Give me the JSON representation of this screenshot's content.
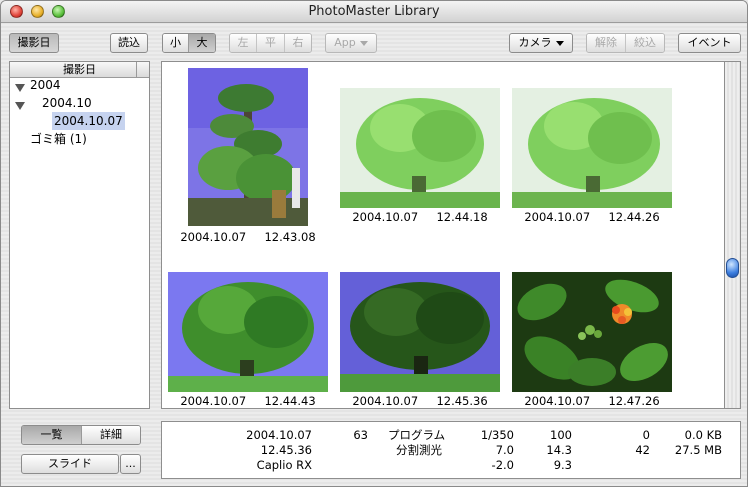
{
  "window": {
    "title": "PhotoMaster Library"
  },
  "toolbar": {
    "date_label": "撮影日",
    "import_label": "読込",
    "size_small": "小",
    "size_large": "大",
    "rotate_left": "左",
    "rotate_flat": "平",
    "rotate_right": "右",
    "app_label": "App",
    "camera_label": "カメラ",
    "unlock_label": "解除",
    "narrow_label": "絞込",
    "event_label": "イベント"
  },
  "sidebar": {
    "header": "撮影日",
    "tree": [
      {
        "label": "2004"
      },
      {
        "label": "2004.10"
      },
      {
        "label": "2004.10.07"
      },
      {
        "label": "ゴミ箱 (1)"
      }
    ]
  },
  "photos": [
    {
      "date": "2004.10.07",
      "time": "12.43.08",
      "icon": "tall-tree-photo"
    },
    {
      "date": "2004.10.07",
      "time": "12.44.18",
      "icon": "bright-tree-photo"
    },
    {
      "date": "2004.10.07",
      "time": "12.44.26",
      "icon": "bright-tree-photo"
    },
    {
      "date": "2004.10.07",
      "time": "12.44.43",
      "icon": "tree-blue-sky-photo"
    },
    {
      "date": "2004.10.07",
      "time": "12.45.36",
      "icon": "dark-tree-photo"
    },
    {
      "date": "2004.10.07",
      "time": "12.47.26",
      "icon": "lantana-flower-photo"
    }
  ],
  "view_buttons": {
    "list_label": "一覧",
    "detail_label": "詳細",
    "slide_label": "スライド",
    "more_label": "..."
  },
  "info": {
    "date": "2004.10.07",
    "time": "12.45.36",
    "camera": "Caplio RX",
    "number": "63",
    "mode": "プログラム",
    "metering": "分割測光",
    "shutter": "1/350",
    "aperture": "7.0",
    "exposure": "-2.0",
    "iso": "100",
    "focal": "14.3",
    "focal2": "9.3",
    "count1": "0",
    "count2": "42",
    "size1": "0.0 KB",
    "size2": "27.5 MB"
  }
}
